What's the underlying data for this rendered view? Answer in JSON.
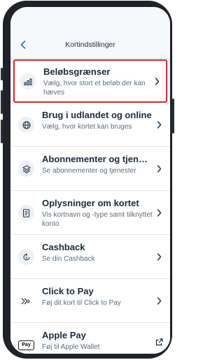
{
  "header": {
    "title": "Kortindstillinger"
  },
  "items": [
    {
      "title": "Beløbsgrænser",
      "subtitle": "Vælg, hvor stort et beløb der kan hæves",
      "icon": "bar-chart-icon",
      "action": "chevron-right-icon",
      "highlighted": true
    },
    {
      "title": "Brug i udlandet og online",
      "subtitle": "Vælg, hvor kortet kan bruges",
      "icon": "globe-icon",
      "action": "chevron-right-icon"
    },
    {
      "title": "Abonnementer og tjenester",
      "subtitle": "Se abonnementer og tjenester",
      "icon": "layers-icon",
      "action": "chevron-right-icon"
    },
    {
      "title": "Oplysninger om kortet",
      "subtitle": "Vis kortnavn og -type samt tilknyttet konto",
      "icon": "document-icon",
      "action": "chevron-right-icon"
    },
    {
      "title": "Cashback",
      "subtitle": "Se din Cashback",
      "icon": "cashback-icon",
      "action": "chevron-right-icon"
    },
    {
      "title": "Click to Pay",
      "subtitle": "Føj dit kort til Click to Pay",
      "icon": "click-to-pay-icon",
      "action": "chevron-right-icon"
    },
    {
      "title": "Apple Pay",
      "subtitle": "Føj til Apple Wallet",
      "icon": "apple-pay-icon",
      "icon_text": "Pay",
      "action": "external-link-icon"
    }
  ],
  "colors": {
    "accent": "#2a6fd6",
    "highlight_border": "#c9302c",
    "title": "#1a2b3c",
    "subtitle": "#5f6b7a"
  }
}
